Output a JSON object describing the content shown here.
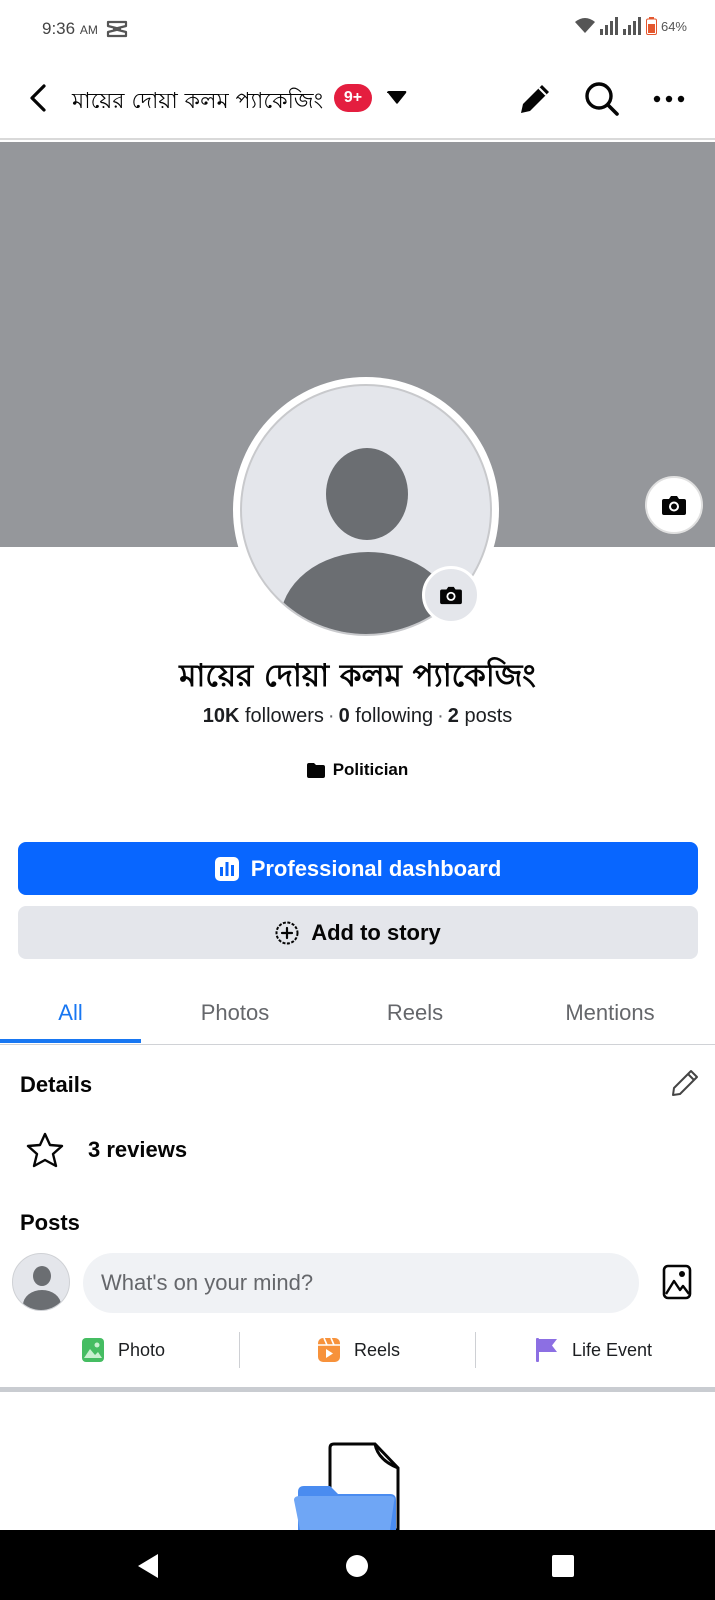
{
  "status_bar": {
    "time": "9:36",
    "ampm": "AM",
    "battery": "64%"
  },
  "top_bar": {
    "title": "মায়ের দোয়া কলম প্যাকেজিং",
    "badge": "9+"
  },
  "profile": {
    "name": "মায়ের দোয়া কলম প্যাকেজিং",
    "followers_count": "10K",
    "followers_label": "followers",
    "following_count": "0",
    "following_label": "following",
    "posts_count": "2",
    "posts_label": "posts",
    "category": "Politician"
  },
  "buttons": {
    "dashboard": "Professional dashboard",
    "add_story": "Add to story"
  },
  "tabs": [
    {
      "label": "All",
      "active": true
    },
    {
      "label": "Photos",
      "active": false
    },
    {
      "label": "Reels",
      "active": false
    },
    {
      "label": "Mentions",
      "active": false
    }
  ],
  "details": {
    "title": "Details",
    "reviews": "3 reviews"
  },
  "posts": {
    "title": "Posts",
    "composer_placeholder": "What's on your mind?",
    "actions": [
      {
        "label": "Photo",
        "icon": "photo-icon",
        "color": "#45bd62"
      },
      {
        "label": "Reels",
        "icon": "reels-icon",
        "color": "#f7923b"
      },
      {
        "label": "Life Event",
        "icon": "flag-icon",
        "color": "#8c6fe3"
      }
    ]
  },
  "colors": {
    "primary": "#0866ff",
    "tab_active": "#1877f2",
    "badge": "#e41e3f",
    "cover": "#95979b"
  }
}
